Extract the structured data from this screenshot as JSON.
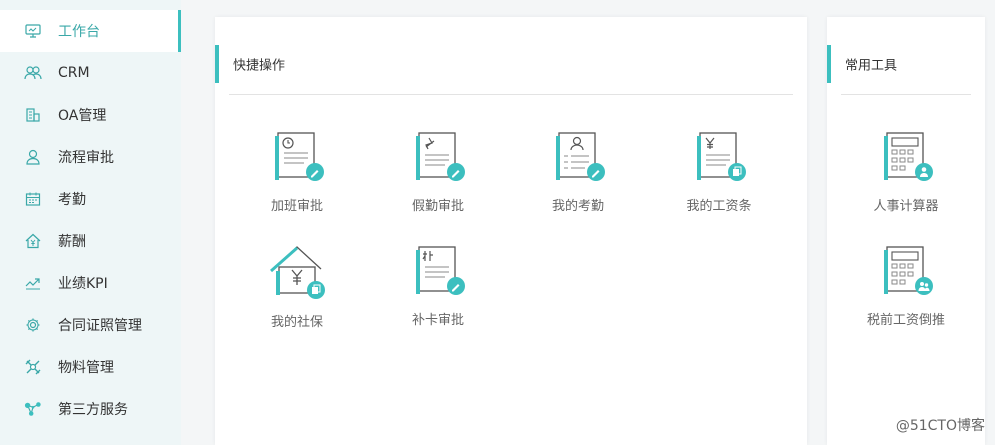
{
  "sidebar": {
    "items": [
      {
        "label": "工作台",
        "icon": "monitor-icon",
        "active": true
      },
      {
        "label": "CRM",
        "icon": "users-icon"
      },
      {
        "label": "OA管理",
        "icon": "building-icon"
      },
      {
        "label": "流程审批",
        "icon": "user-icon"
      },
      {
        "label": "考勤",
        "icon": "calendar-icon"
      },
      {
        "label": "薪酬",
        "icon": "house-yen-icon"
      },
      {
        "label": "业绩KPI",
        "icon": "trend-chart-icon"
      },
      {
        "label": "合同证照管理",
        "icon": "gear-icon"
      },
      {
        "label": "物料管理",
        "icon": "recycle-icon"
      },
      {
        "label": "第三方服务",
        "icon": "network-icon"
      }
    ]
  },
  "quick_actions": {
    "title": "快捷操作",
    "items": [
      {
        "label": "加班审批",
        "icon": "clock-document-icon"
      },
      {
        "label": "假勤审批",
        "icon": "plane-document-icon"
      },
      {
        "label": "我的考勤",
        "icon": "person-document-icon"
      },
      {
        "label": "我的工资条",
        "icon": "yen-document-icon"
      },
      {
        "label": "我的社保",
        "icon": "house-yen-icon"
      },
      {
        "label": "补卡审批",
        "icon": "card-document-icon"
      }
    ]
  },
  "tools": {
    "title": "常用工具",
    "items": [
      {
        "label": "人事计算器",
        "icon": "calculator-person-icon"
      },
      {
        "label": "税前工资倒推",
        "icon": "calculator-people-icon"
      }
    ]
  },
  "watermark": "@51CTO博客",
  "colors": {
    "accent": "#3cbfbf",
    "sidebar_bg": "#eef6f7"
  }
}
